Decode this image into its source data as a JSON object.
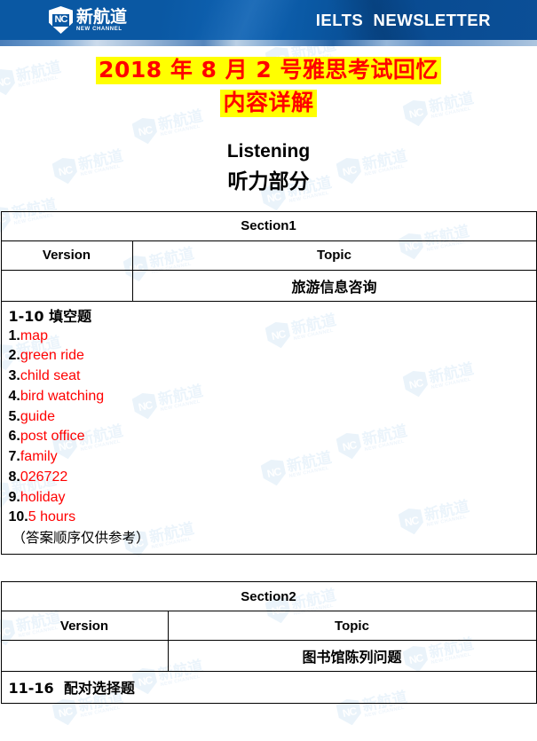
{
  "banner": {
    "logo": {
      "mark": "NC",
      "cn_name": "新航道",
      "en_name": "NEW CHANNEL"
    },
    "title": "IELTS  NEWSLETTER",
    "bg_color": "#0a58a3"
  },
  "watermark": {
    "mark": "NC",
    "cn_name": "新航道",
    "en_name": "NEW CHANNEL",
    "color": "#d9eaf8"
  },
  "title": {
    "line1": "2018 年 8 月 2 号雅思考试回忆",
    "line2": "内容详解",
    "text_color": "#ff0000",
    "highlight_color": "#ffff00"
  },
  "listening": {
    "en": "Listening",
    "cn": "听力部分"
  },
  "section1": {
    "header": "Section1",
    "col_version": "Version",
    "col_topic": "Topic",
    "version_value": "",
    "topic_value": "旅游信息咨询",
    "answers_title": "1-10 填空题",
    "answers": [
      {
        "num": "1.",
        "value": "map"
      },
      {
        "num": "2.",
        "value": "green ride"
      },
      {
        "num": "3.",
        "value": "child seat"
      },
      {
        "num": "4.",
        "value": "bird watching"
      },
      {
        "num": "5.",
        "value": "guide"
      },
      {
        "num": "6.",
        "value": "post office"
      },
      {
        "num": "7.",
        "value": "family"
      },
      {
        "num": "8.",
        "value": "026722"
      },
      {
        "num": "9.",
        "value": "holiday"
      },
      {
        "num": "10.",
        "value": "5 hours"
      }
    ],
    "note": "（答案顺序仅供参考）"
  },
  "section2": {
    "header": "Section2",
    "col_version": "Version",
    "col_topic": "Topic",
    "version_value": "",
    "topic_value": "图书馆陈列问题",
    "question_label": "11-16  配对选择题"
  }
}
